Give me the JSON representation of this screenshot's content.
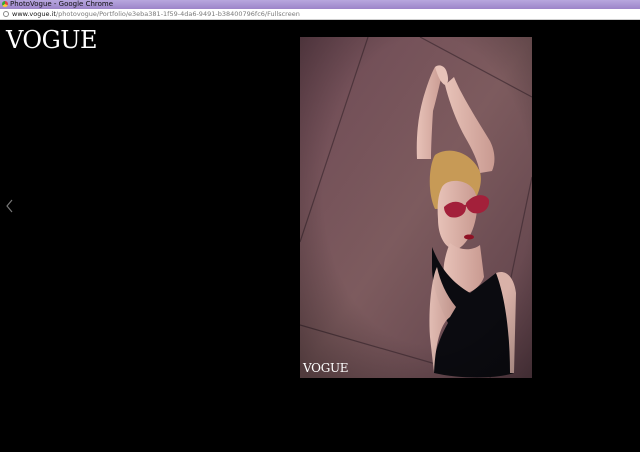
{
  "window": {
    "title": "PhotoVogue - Google Chrome"
  },
  "address_bar": {
    "host": "www.vogue.it",
    "path": "/photovogue/Portfolio/e3eba381-1f59-4da6-9491-b38400796fc6/Fullscreen"
  },
  "site": {
    "logo": "VOGUE"
  },
  "gallery": {
    "prev_icon": "chevron-left-icon",
    "watermark": "VOGUE"
  }
}
